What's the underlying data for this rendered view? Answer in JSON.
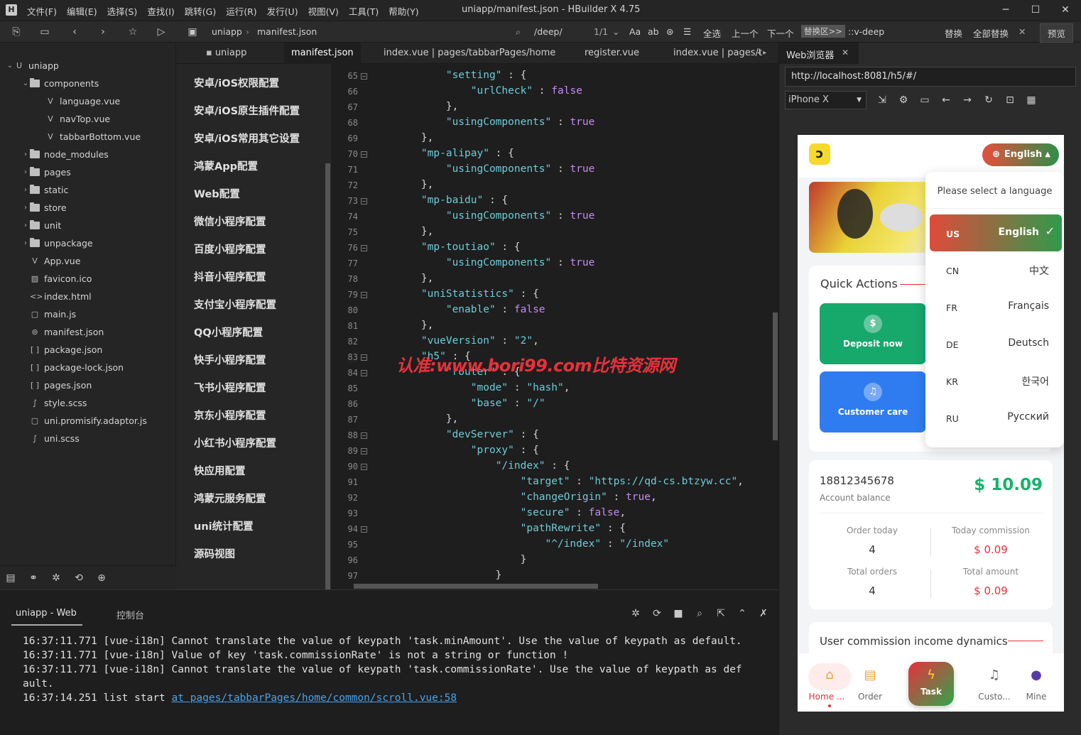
{
  "window": {
    "title": "uniapp/manifest.json - HBuilder X 4.75",
    "menu": [
      "文件(F)",
      "编辑(E)",
      "选择(S)",
      "查找(I)",
      "跳转(G)",
      "运行(R)",
      "发行(U)",
      "视图(V)",
      "工具(T)",
      "帮助(Y)"
    ]
  },
  "toolbar": {
    "breadcrumb_root": "uniapp",
    "breadcrumb_file": "manifest.json",
    "find_value": "/deep/",
    "match_count": "1/1",
    "find_options": [
      "Aa",
      "ab",
      "全选",
      "上一个",
      "下一个"
    ],
    "replace_toggle": "替换区>>",
    "replace_value": "::v-deep",
    "replace_label": "替换",
    "replace_all_label": "全部替换",
    "preview_label": "预览"
  },
  "explorer": {
    "items": [
      {
        "label": "uniapp",
        "indent": 0,
        "type": "project",
        "open": true
      },
      {
        "label": "components",
        "indent": 1,
        "type": "folder",
        "open": true
      },
      {
        "label": "language.vue",
        "indent": 2,
        "type": "vue"
      },
      {
        "label": "navTop.vue",
        "indent": 2,
        "type": "vue"
      },
      {
        "label": "tabbarBottom.vue",
        "indent": 2,
        "type": "vue"
      },
      {
        "label": "node_modules",
        "indent": 1,
        "type": "folder"
      },
      {
        "label": "pages",
        "indent": 1,
        "type": "folder"
      },
      {
        "label": "static",
        "indent": 1,
        "type": "folder"
      },
      {
        "label": "store",
        "indent": 1,
        "type": "folder"
      },
      {
        "label": "unit",
        "indent": 1,
        "type": "folder"
      },
      {
        "label": "unpackage",
        "indent": 1,
        "type": "folder"
      },
      {
        "label": "App.vue",
        "indent": 1,
        "type": "vue"
      },
      {
        "label": "favicon.ico",
        "indent": 1,
        "type": "image"
      },
      {
        "label": "index.html",
        "indent": 1,
        "type": "html"
      },
      {
        "label": "main.js",
        "indent": 1,
        "type": "js"
      },
      {
        "label": "manifest.json",
        "indent": 1,
        "type": "manifest"
      },
      {
        "label": "package.json",
        "indent": 1,
        "type": "json"
      },
      {
        "label": "package-lock.json",
        "indent": 1,
        "type": "json"
      },
      {
        "label": "pages.json",
        "indent": 1,
        "type": "json"
      },
      {
        "label": "style.scss",
        "indent": 1,
        "type": "scss"
      },
      {
        "label": "uni.promisify.adaptor.js",
        "indent": 1,
        "type": "js"
      },
      {
        "label": "uni.scss",
        "indent": 1,
        "type": "scss"
      }
    ]
  },
  "tabs": [
    "uniapp",
    "manifest.json",
    "index.vue | pages/tabbarPages/home",
    "register.vue",
    "index.vue | pages/t"
  ],
  "config_nav": [
    "安卓/iOS权限配置",
    "安卓/iOS原生插件配置",
    "安卓/iOS常用其它设置",
    "鸿蒙App配置",
    "Web配置",
    "微信小程序配置",
    "百度小程序配置",
    "抖音小程序配置",
    "支付宝小程序配置",
    "QQ小程序配置",
    "快手小程序配置",
    "飞书小程序配置",
    "京东小程序配置",
    "小红书小程序配置",
    "快应用配置",
    "鸿蒙元服务配置",
    "uni统计配置",
    "源码视图"
  ],
  "code": [
    {
      "n": "65",
      "fold": true,
      "t": "        <s>\"setting\"</s> : {"
    },
    {
      "n": "66",
      "t": "            <s>\"urlCheck\"</s> : <k>false</k>"
    },
    {
      "n": "67",
      "t": "        },"
    },
    {
      "n": "68",
      "t": "        <s>\"usingComponents\"</s> : <k>true</k>"
    },
    {
      "n": "69",
      "t": "    },"
    },
    {
      "n": "70",
      "fold": true,
      "t": "    <s>\"mp-alipay\"</s> : {"
    },
    {
      "n": "71",
      "t": "        <s>\"usingComponents\"</s> : <k>true</k>"
    },
    {
      "n": "72",
      "t": "    },"
    },
    {
      "n": "73",
      "fold": true,
      "t": "    <s>\"mp-baidu\"</s> : {"
    },
    {
      "n": "74",
      "t": "        <s>\"usingComponents\"</s> : <k>true</k>"
    },
    {
      "n": "75",
      "t": "    },"
    },
    {
      "n": "76",
      "fold": true,
      "t": "    <s>\"mp-toutiao\"</s> : {"
    },
    {
      "n": "77",
      "t": "        <s>\"usingComponents\"</s> : <k>true</k>"
    },
    {
      "n": "78",
      "t": "    },"
    },
    {
      "n": "79",
      "fold": true,
      "t": "    <s>\"uniStatistics\"</s> : {"
    },
    {
      "n": "80",
      "t": "        <s>\"enable\"</s> : <k>false</k>"
    },
    {
      "n": "81",
      "t": "    },"
    },
    {
      "n": "82",
      "t": "    <s>\"vueVersion\"</s> : <s>\"2\"</s>,"
    },
    {
      "n": "83",
      "fold": true,
      "t": "    <s>\"h5\"</s> : {"
    },
    {
      "n": "84",
      "fold": true,
      "t": "        <s>\"router\"</s> : {"
    },
    {
      "n": "85",
      "t": "            <s>\"mode\"</s> : <s>\"hash\"</s>,"
    },
    {
      "n": "86",
      "t": "            <s>\"base\"</s> : <s>\"/\"</s>"
    },
    {
      "n": "87",
      "t": "        },"
    },
    {
      "n": "88",
      "fold": true,
      "t": "        <s>\"devServer\"</s> : {"
    },
    {
      "n": "89",
      "fold": true,
      "t": "            <s>\"proxy\"</s> : {"
    },
    {
      "n": "90",
      "fold": true,
      "t": "                <s>\"/index\"</s> : {"
    },
    {
      "n": "91",
      "t": "                    <s>\"target\"</s> : <s>\"https://qd-cs.btzyw.cc\"</s>,"
    },
    {
      "n": "92",
      "t": "                    <s>\"changeOrigin\"</s> : <k>true</k>,"
    },
    {
      "n": "93",
      "t": "                    <s>\"secure\"</s> : <k>false</k>,"
    },
    {
      "n": "94",
      "fold": true,
      "t": "                    <s>\"pathRewrite\"</s> : {"
    },
    {
      "n": "95",
      "t": "                        <s>\"^/index\"</s> : <s>\"/index\"</s>"
    },
    {
      "n": "96",
      "t": "                    }"
    },
    {
      "n": "97",
      "t": "                }"
    }
  ],
  "watermark": "认准:www.bori99.com比特资源网",
  "console": {
    "tab_web": "uniapp - Web",
    "tab_console": "控制台",
    "lines": [
      "16:37:11.771 [vue-i18n] Cannot translate the value of keypath 'task.minAmount'. Use the value of keypath as default.",
      "16:37:11.771 [vue-i18n] Value of key 'task.commissionRate' is not a string or function !",
      "16:37:11.771 [vue-i18n] Cannot translate the value of keypath 'task.commissionRate'. Use the value of keypath as def",
      "ault."
    ],
    "last_prefix": "16:37:14.251 list start ",
    "last_link": "at pages/tabbarPages/home/common/scroll.vue:58"
  },
  "browser": {
    "tab": "Web浏览器",
    "url": "http://localhost:8081/h5/#/",
    "device": "iPhone X"
  },
  "phone": {
    "lang_button": "English",
    "dropdown_title": "Please select a language",
    "languages": [
      {
        "code": "US",
        "name": "English",
        "selected": true
      },
      {
        "code": "CN",
        "name": "中文"
      },
      {
        "code": "FR",
        "name": "Français"
      },
      {
        "code": "DE",
        "name": "Deutsch"
      },
      {
        "code": "KR",
        "name": "한국어"
      },
      {
        "code": "RU",
        "name": "Русский"
      }
    ],
    "quick_actions_title": "Quick Actions",
    "deposit_label": "Deposit now",
    "care_label": "Customer care",
    "account": "18812345678",
    "balance": "$ 10.09",
    "balance_label": "Account balance",
    "stats": {
      "order_today_label": "Order today",
      "order_today": "4",
      "commission_today_label": "Today commission",
      "commission_today": "$ 0.09",
      "total_orders_label": "Total orders",
      "total_orders": "4",
      "total_amount_label": "Total amount",
      "total_amount": "$ 0.09"
    },
    "dynamics_title": "User commission income dynamics",
    "tabbar": [
      "Home ...",
      "Order",
      "Task",
      "Custo...",
      "Mine"
    ]
  },
  "colors": {
    "accent_green": "#17b26a",
    "accent_red": "#e8313b",
    "string": "#6ecbd8",
    "keyword": "#c48cf0"
  }
}
